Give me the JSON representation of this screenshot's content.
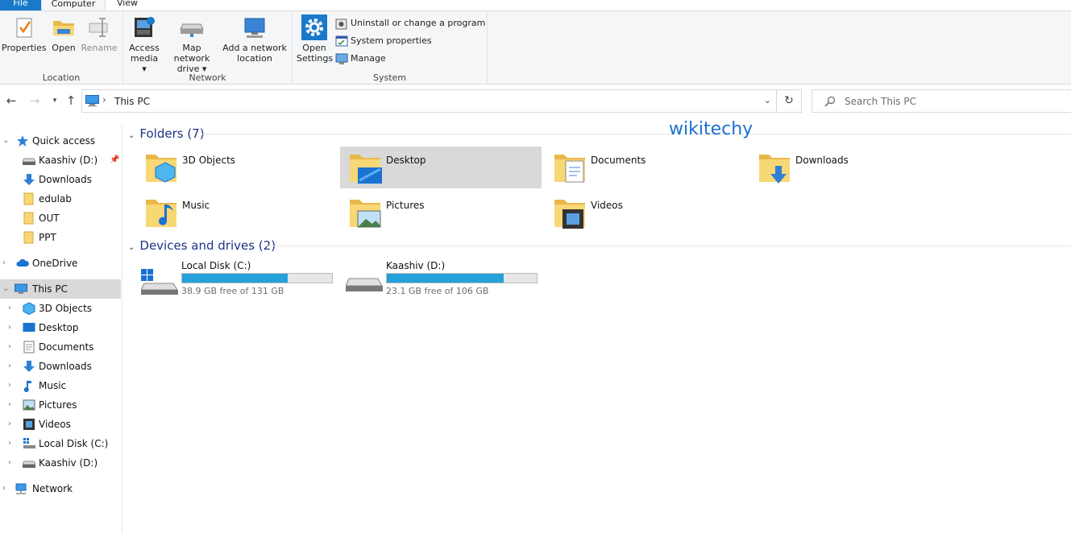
{
  "tabs": {
    "file": "File",
    "computer": "Computer",
    "view": "View"
  },
  "ribbon": {
    "location": {
      "label": "Location",
      "properties": "Properties",
      "open": "Open",
      "rename": "Rename"
    },
    "network": {
      "label": "Network",
      "access_media_1": "Access",
      "access_media_2": "media ▾",
      "map_drive_1": "Map network",
      "map_drive_2": "drive ▾",
      "add_location_1": "Add a network",
      "add_location_2": "location"
    },
    "system": {
      "label": "System",
      "open_settings_1": "Open",
      "open_settings_2": "Settings",
      "uninstall": "Uninstall or change a program",
      "system_properties": "System properties",
      "manage": "Manage"
    }
  },
  "address": {
    "path": "This PC",
    "search_placeholder": "Search This PC"
  },
  "sidebar": {
    "quick_access": "Quick access",
    "quick_items": [
      "Kaashiv (D:)",
      "Downloads",
      "edulab",
      "OUT",
      "PPT"
    ],
    "onedrive": "OneDrive",
    "this_pc": "This PC",
    "pc_items": [
      "3D Objects",
      "Desktop",
      "Documents",
      "Downloads",
      "Music",
      "Pictures",
      "Videos",
      "Local Disk (C:)",
      "Kaashiv (D:)"
    ],
    "network": "Network"
  },
  "content": {
    "watermark": "wikitechy",
    "folders_header": "Folders (7)",
    "folders": [
      "3D Objects",
      "Desktop",
      "Documents",
      "Downloads",
      "Music",
      "Pictures",
      "Videos"
    ],
    "drives_header": "Devices and drives (2)",
    "drives": [
      {
        "name": "Local Disk (C:)",
        "free": "38.9 GB free of 131 GB",
        "used_fraction": 0.703
      },
      {
        "name": "Kaashiv (D:)",
        "free": "23.1 GB free of 106 GB",
        "used_fraction": 0.782
      }
    ]
  },
  "colors": {
    "accent": "#1979ca",
    "drive_bar": "#26a0da",
    "folder": "#f8d775",
    "header_text": "#1e3287"
  }
}
